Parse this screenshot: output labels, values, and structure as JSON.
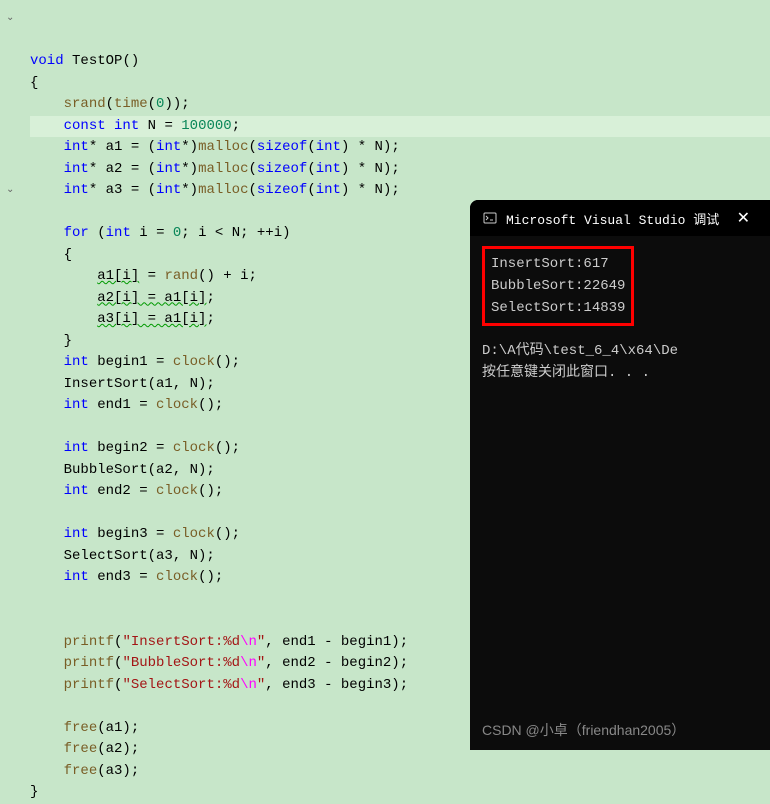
{
  "code": {
    "fn_sig": "void TestOP()",
    "l_srand": "srand(time(0));",
    "l_const": "const int N = 100000;",
    "l_a1": "int* a1 = (int*)malloc(sizeof(int) * N);",
    "l_a2": "int* a2 = (int*)malloc(sizeof(int) * N);",
    "l_a3": "int* a3 = (int*)malloc(sizeof(int) * N);",
    "l_for": "for (int i = 0; i < N; ++i)",
    "l_b1": "a1[i] = rand() + i;",
    "l_b2": "a2[i] = a1[i];",
    "l_b3": "a3[i] = a1[i];",
    "l_beg1": "int begin1 = clock();",
    "l_ins": "InsertSort(a1, N);",
    "l_end1": "int end1 = clock();",
    "l_beg2": "int begin2 = clock();",
    "l_bub": "BubbleSort(a2, N);",
    "l_end2": "int end2 = clock();",
    "l_beg3": "int begin3 = clock();",
    "l_sel": "SelectSort(a3, N);",
    "l_end3": "int end3 = clock();",
    "l_pf1a": "printf(",
    "l_pf1b": "\"InsertSort:%d",
    "l_pf1c": "\\n",
    "l_pf1d": "\"",
    "l_pf1e": ", end1 - begin1);",
    "l_pf2a": "printf(",
    "l_pf2b": "\"BubbleSort:%d",
    "l_pf2c": "\\n",
    "l_pf2d": "\"",
    "l_pf2e": ", end2 - begin2);",
    "l_pf3a": "printf(",
    "l_pf3b": "\"SelectSort:%d",
    "l_pf3c": "\\n",
    "l_pf3d": "\"",
    "l_pf3e": ", end3 - begin3);",
    "l_f1": "free(a1);",
    "l_f2": "free(a2);",
    "l_f3": "free(a3);"
  },
  "console": {
    "title": "Microsoft Visual Studio 调试",
    "out1": "InsertSort:617",
    "out2": "BubbleSort:22649",
    "out3": "SelectSort:14839",
    "path": "D:\\A代码\\test_6_4\\x64\\De",
    "prompt": "按任意键关闭此窗口. . .",
    "watermark": "CSDN @小卓（friendhan2005）"
  }
}
